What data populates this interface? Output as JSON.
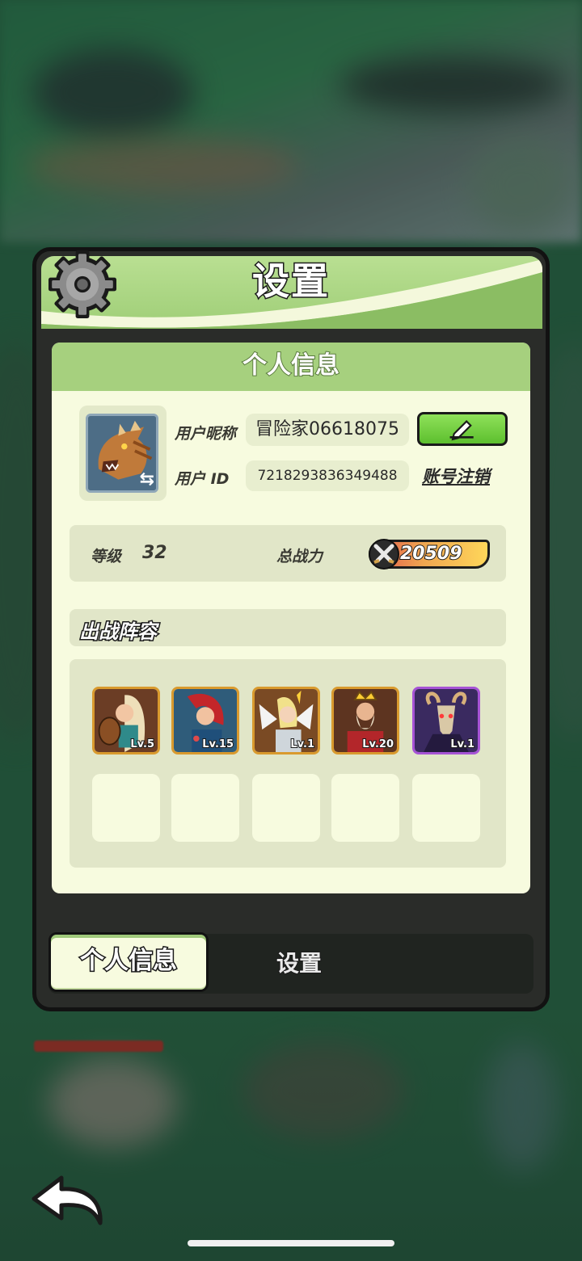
{
  "window": {
    "title": "设置"
  },
  "card": {
    "heading": "个人信息"
  },
  "profile": {
    "nickname_label": "用户昵称",
    "nickname": "冒险家06618075",
    "id_label": "用户 ID",
    "user_id": "7218293836349488",
    "cancel_account": "账号注销"
  },
  "stats": {
    "level_label": "等级",
    "level": "32",
    "power_label": "总战力",
    "power": "20509"
  },
  "team": {
    "heading": "出战阵容",
    "heroes": [
      {
        "level": "Lv.5",
        "icon": "bard-hero-portrait",
        "frame": "#d99a2e"
      },
      {
        "level": "Lv.15",
        "icon": "red-hair-hero-portrait",
        "frame": "#d99a2e"
      },
      {
        "level": "Lv.1",
        "icon": "angel-hero-portrait",
        "frame": "#d99a2e"
      },
      {
        "level": "Lv.20",
        "icon": "king-hero-portrait",
        "frame": "#d99a2e"
      },
      {
        "level": "Lv.1",
        "icon": "goat-demon-hero-portrait",
        "frame": "#a653d6"
      }
    ],
    "empty_slots": 5
  },
  "tabs": [
    {
      "label": "个人信息",
      "active": true
    },
    {
      "label": "设置",
      "active": false
    }
  ],
  "colors": {
    "accent_green": "#9fce77",
    "panel_dark": "#2a2c29",
    "card_bg": "#f7fbdf",
    "gold_frame": "#d99a2e",
    "purple_frame": "#a653d6"
  }
}
